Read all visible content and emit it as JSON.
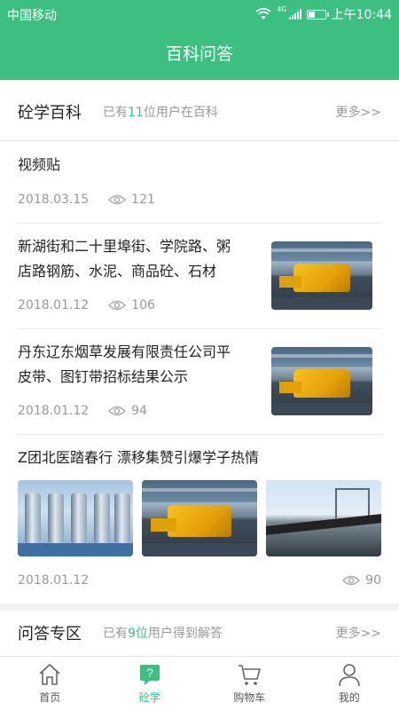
{
  "status": {
    "carrier": "中国移动",
    "time": "上午10:44",
    "network": "4G"
  },
  "header": {
    "title": "百科问答"
  },
  "encyclopedia": {
    "title": "砼学百科",
    "sub_prefix": "已有",
    "sub_count": "11",
    "sub_suffix": "位用户在百科",
    "more": "更多>>"
  },
  "articles": [
    {
      "title": "视频贴",
      "date": "2018.03.15",
      "views": "121"
    },
    {
      "title_line1": "新湖街和二十里埠街、学院路、粥",
      "title_line2": "店路钢筋、水泥、商品砼、石材",
      "date": "2018.01.12",
      "views": "106"
    },
    {
      "title_line1": "丹东辽东烟草发展有限责任公司平",
      "title_line2": "皮带、图钉带招标结果公示",
      "date": "2018.01.12",
      "views": "94"
    },
    {
      "title": "Z团北医踏春行 漂移集赞引爆学子热情",
      "date": "2018.01.12",
      "views": "90"
    }
  ],
  "qa": {
    "title": "问答专区",
    "sub_prefix": "已有",
    "sub_count": "9位",
    "sub_suffix": "用户得到解答",
    "more": "更多>>"
  },
  "tabs": [
    {
      "label": "首页",
      "icon": "home-icon"
    },
    {
      "label": "砼学",
      "icon": "question-icon"
    },
    {
      "label": "购物车",
      "icon": "cart-icon"
    },
    {
      "label": "我的",
      "icon": "user-icon"
    }
  ],
  "colors": {
    "accent": "#3dbf81",
    "muted": "#999999"
  }
}
